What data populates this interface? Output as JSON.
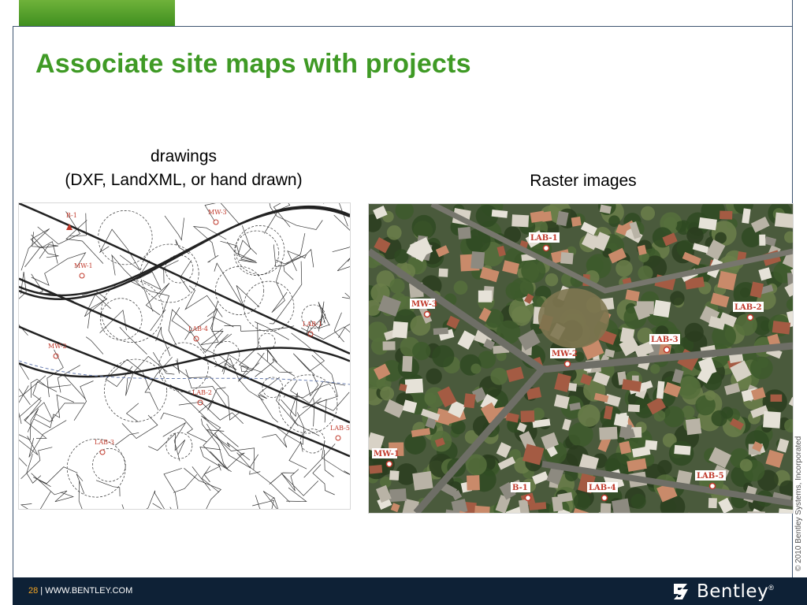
{
  "slide": {
    "title": "Associate site maps with projects",
    "caption_left_line1": "drawings",
    "caption_left_line2": "(DXF, LandXML, or hand drawn)",
    "caption_right": "Raster images"
  },
  "drawing_labels": [
    "B-1",
    "MW-3",
    "MW-1",
    "LAB-1",
    "LAB-4",
    "MW-2",
    "LAB-2",
    "LAB-5",
    "LAB-3"
  ],
  "raster_labels": [
    "LAB-1",
    "MW-3",
    "LAB-2",
    "LAB-3",
    "MW-2",
    "MW-1",
    "B-1",
    "LAB-4",
    "LAB-5"
  ],
  "footer": {
    "page": "28",
    "separator": " | ",
    "site": "WWW.BENTLEY.COM",
    "logo_text": "Bentley",
    "logo_mark": "®",
    "copyright": "© 2010 Bentley Systems, Incorporated"
  },
  "colors": {
    "title": "#3f9a25",
    "accent_tab": "#4f9e2a",
    "footer_bg": "#0e2136",
    "page_number": "#f5a623"
  },
  "icons": [
    "bentley-logo-icon"
  ]
}
